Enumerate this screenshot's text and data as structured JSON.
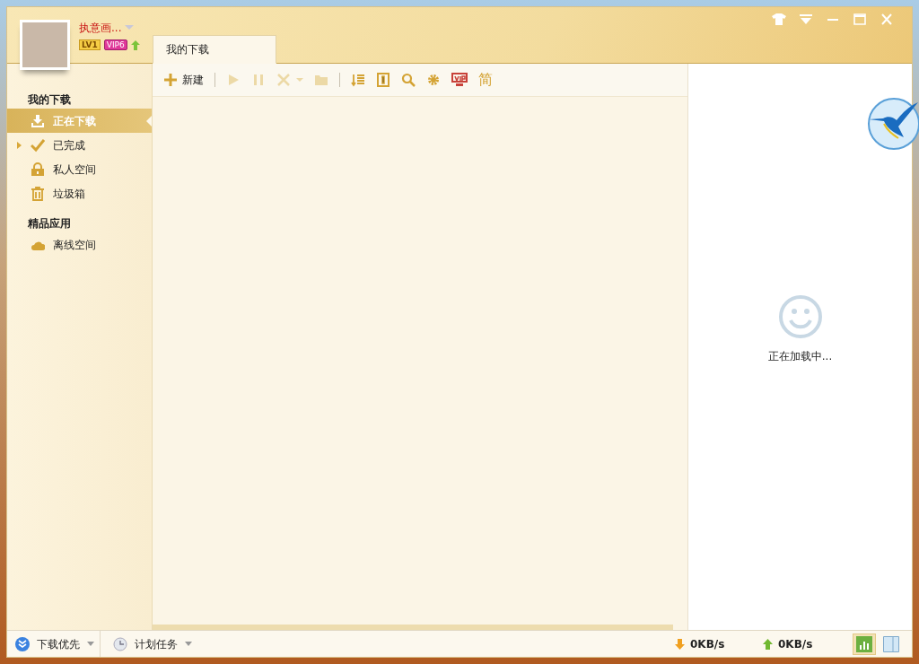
{
  "user": {
    "name": "执意画...",
    "level_badge": "LV1",
    "vip_badge": "VIP6"
  },
  "tabs": [
    {
      "label": "我的下载",
      "selected": true
    }
  ],
  "toolbar": [
    {
      "label": "新建",
      "disabled": false
    },
    {
      "disabled": true
    },
    {
      "disabled": true
    },
    {
      "disabled": true
    },
    {
      "disabled": true
    },
    {
      "disabled": true
    },
    {
      "disabled": false
    },
    {
      "disabled": false
    },
    {
      "disabled": false
    },
    {
      "disabled": false
    },
    {
      "disabled": false
    },
    {
      "label": "简",
      "disabled": false
    }
  ],
  "sidebar": [
    {
      "title": "我的下载",
      "items": [
        {
          "label": "正在下载",
          "selected": true,
          "has_children": false
        },
        {
          "label": "已完成",
          "selected": false,
          "has_children": true
        },
        {
          "label": "私人空间",
          "selected": false,
          "has_children": false
        },
        {
          "label": "垃圾箱",
          "selected": false,
          "has_children": false
        }
      ]
    },
    {
      "title": "精品应用",
      "items": [
        {
          "label": "离线空间",
          "selected": false,
          "has_children": false
        }
      ]
    }
  ],
  "detail": {
    "loading_text": "正在加载中..."
  },
  "status_bar": {
    "priority": "下载优先",
    "schedule": "计划任务",
    "download_speed": "0KB/s",
    "upload_speed": "0KB/s",
    "views": [
      {
        "selected": true
      },
      {
        "selected": false
      }
    ]
  }
}
